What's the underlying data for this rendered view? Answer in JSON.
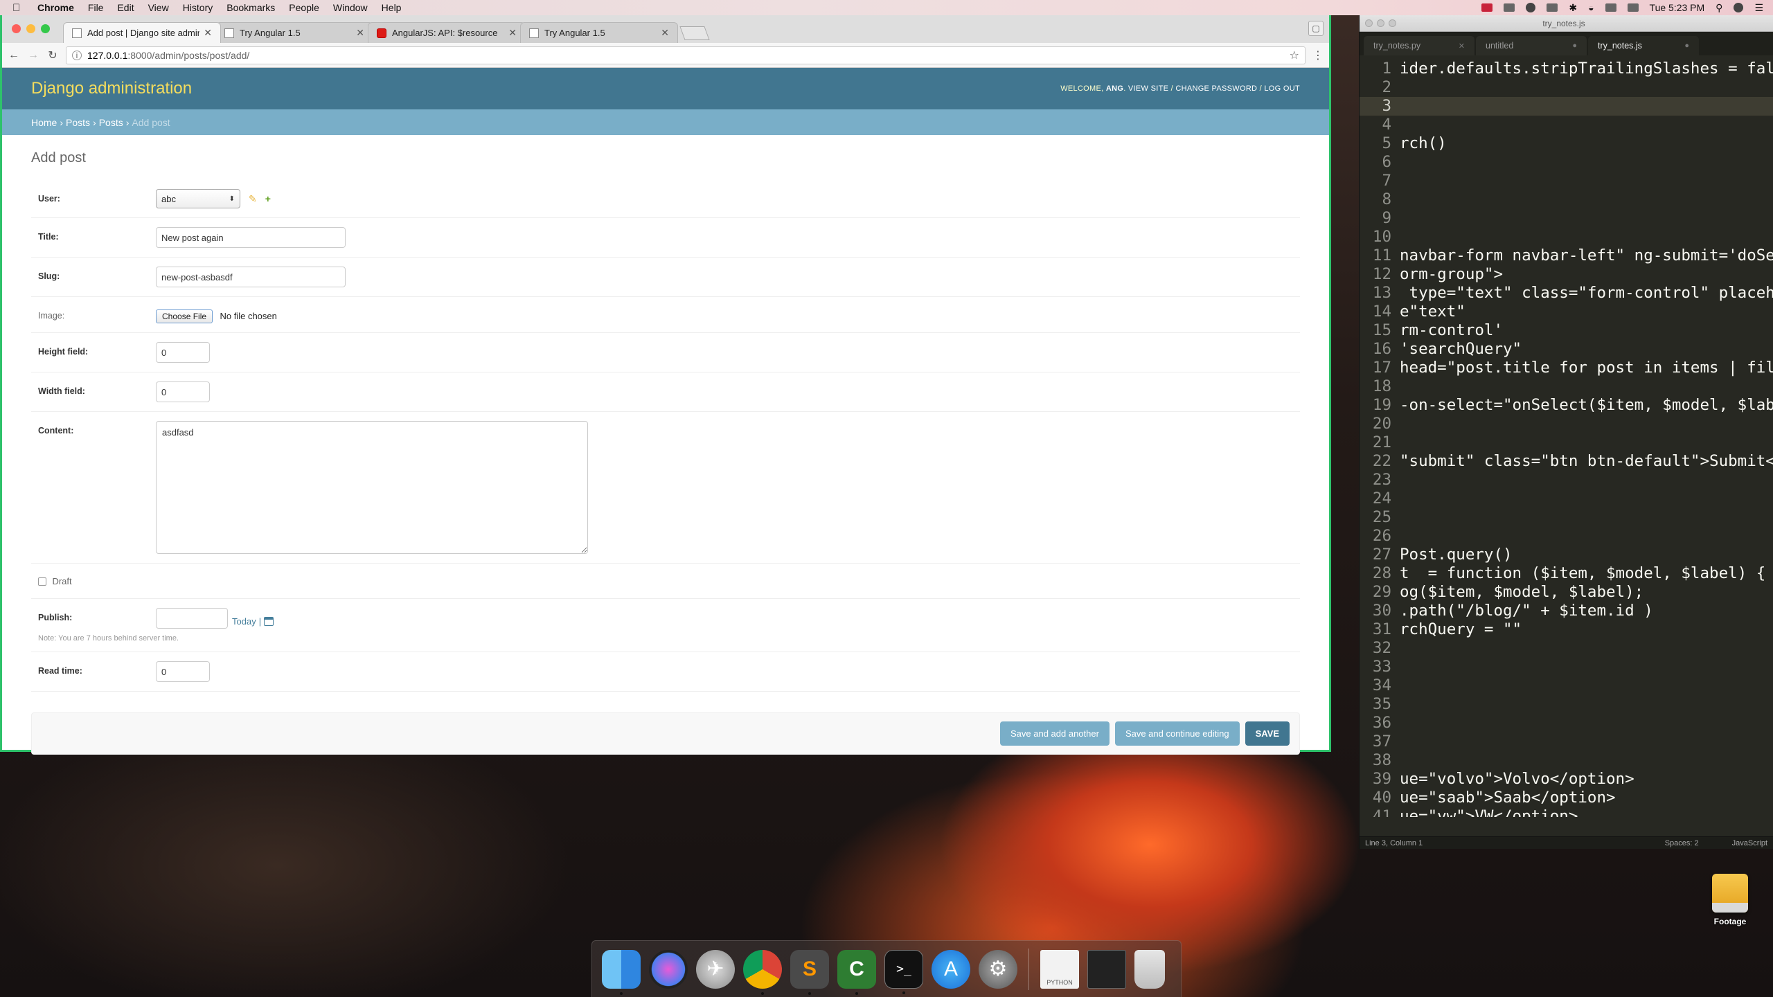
{
  "menubar": {
    "apple": "",
    "app": "Chrome",
    "items": [
      "File",
      "Edit",
      "View",
      "History",
      "Bookmarks",
      "People",
      "Window",
      "Help"
    ],
    "clock": "Tue 5:23 PM"
  },
  "chrome": {
    "tabs": [
      {
        "title": "Add post | Django site admin",
        "icon": "page-icon"
      },
      {
        "title": "Try Angular 1.5",
        "icon": "page-icon"
      },
      {
        "title": "AngularJS: API: $resource",
        "icon": "angular-icon"
      },
      {
        "title": "Try Angular 1.5",
        "icon": "page-icon"
      }
    ],
    "url_host": "127.0.0.1",
    "url_path": ":8000/admin/posts/post/add/"
  },
  "admin": {
    "brand": "Django administration",
    "welcome": "WELCOME, ",
    "user": "ANG",
    "view_site": "VIEW SITE",
    "change_password": "CHANGE PASSWORD",
    "log_out": "LOG OUT",
    "breadcrumbs": [
      "Home",
      "Posts",
      "Posts",
      "Add post"
    ],
    "page_title": "Add post",
    "fields": {
      "user": {
        "label": "User:",
        "value": "abc"
      },
      "title": {
        "label": "Title:",
        "value": "New post again"
      },
      "slug": {
        "label": "Slug:",
        "value": "new-post-asbasdf"
      },
      "image": {
        "label": "Image:",
        "button": "Choose File",
        "status": "No file chosen"
      },
      "height": {
        "label": "Height field:",
        "value": "0"
      },
      "width": {
        "label": "Width field:",
        "value": "0"
      },
      "content": {
        "label": "Content:",
        "value": "asdfasd"
      },
      "draft": {
        "label": "Draft"
      },
      "publish": {
        "label": "Publish:",
        "value": "",
        "today": "Today",
        "sep": "|",
        "help": "Note: You are 7 hours behind server time."
      },
      "read_time": {
        "label": "Read time:",
        "value": "0"
      }
    },
    "buttons": {
      "save_add": "Save and add another",
      "save_continue": "Save and continue editing",
      "save": "SAVE"
    },
    "colors": {
      "header": "#417690",
      "breadcrumbs": "#79aec8",
      "brand": "#f5dd5d"
    }
  },
  "sublime": {
    "window_title": "try_notes.js",
    "tabs": [
      "try_notes.py",
      "untitled",
      "try_notes.js"
    ],
    "active_tab": 2,
    "status_left": "Line 3, Column 1",
    "status_spaces": "Spaces: 2",
    "status_syntax": "JavaScript",
    "lines": [
      {
        "n": "1",
        "t": "ider.defaults.stripTrailingSlashes = fals"
      },
      {
        "n": "2",
        "t": ""
      },
      {
        "n": "3",
        "t": ""
      },
      {
        "n": "4",
        "t": ""
      },
      {
        "n": "5",
        "t": "rch()"
      },
      {
        "n": "6",
        "t": ""
      },
      {
        "n": "7",
        "t": ""
      },
      {
        "n": "8",
        "t": ""
      },
      {
        "n": "9",
        "t": ""
      },
      {
        "n": "10",
        "t": ""
      },
      {
        "n": "11",
        "t": "navbar-form navbar-left\" ng-submit='doSea"
      },
      {
        "n": "12",
        "t": "orm-group\">"
      },
      {
        "n": "13",
        "t": " type=\"text\" class=\"form-control\" placeho"
      },
      {
        "n": "14",
        "t": "e\"text\""
      },
      {
        "n": "15",
        "t": "rm-control'"
      },
      {
        "n": "16",
        "t": "'searchQuery\""
      },
      {
        "n": "17",
        "t": "head=\"post.title for post in items | filt"
      },
      {
        "n": "18",
        "t": ""
      },
      {
        "n": "19",
        "t": "-on-select=\"onSelect($item, $model, $labe"
      },
      {
        "n": "20",
        "t": ""
      },
      {
        "n": "21",
        "t": ""
      },
      {
        "n": "22",
        "t": "\"submit\" class=\"btn btn-default\">Submit</"
      },
      {
        "n": "23",
        "t": ""
      },
      {
        "n": "24",
        "t": ""
      },
      {
        "n": "25",
        "t": ""
      },
      {
        "n": "26",
        "t": ""
      },
      {
        "n": "27",
        "t": "Post.query()"
      },
      {
        "n": "28",
        "t": "t  = function ($item, $model, $label) {"
      },
      {
        "n": "29",
        "t": "og($item, $model, $label);"
      },
      {
        "n": "30",
        "t": ".path(\"/blog/\" + $item.id )"
      },
      {
        "n": "31",
        "t": "rchQuery = \"\""
      },
      {
        "n": "32",
        "t": ""
      },
      {
        "n": "33",
        "t": ""
      },
      {
        "n": "34",
        "t": ""
      },
      {
        "n": "35",
        "t": ""
      },
      {
        "n": "36",
        "t": ""
      },
      {
        "n": "37",
        "t": ""
      },
      {
        "n": "38",
        "t": ""
      },
      {
        "n": "39",
        "t": "ue=\"volvo\">Volvo</option>"
      },
      {
        "n": "40",
        "t": "ue=\"saab\">Saab</option>"
      },
      {
        "n": "41",
        "t": "ue=\"vw\">VW</option>"
      }
    ],
    "current_line": 3
  },
  "desktop": {
    "icon_label": "Footage"
  },
  "dock": {
    "apps": [
      "finder-icon",
      "siri-icon",
      "launchpad-icon",
      "chrome-icon",
      "sublime-text-icon",
      "camtasia-icon",
      "terminal-icon",
      "app-store-icon",
      "system-preferences-icon",
      "python-doc-icon",
      "screen-recorder-icon",
      "trash-icon"
    ],
    "python_label": "PYTHON"
  }
}
